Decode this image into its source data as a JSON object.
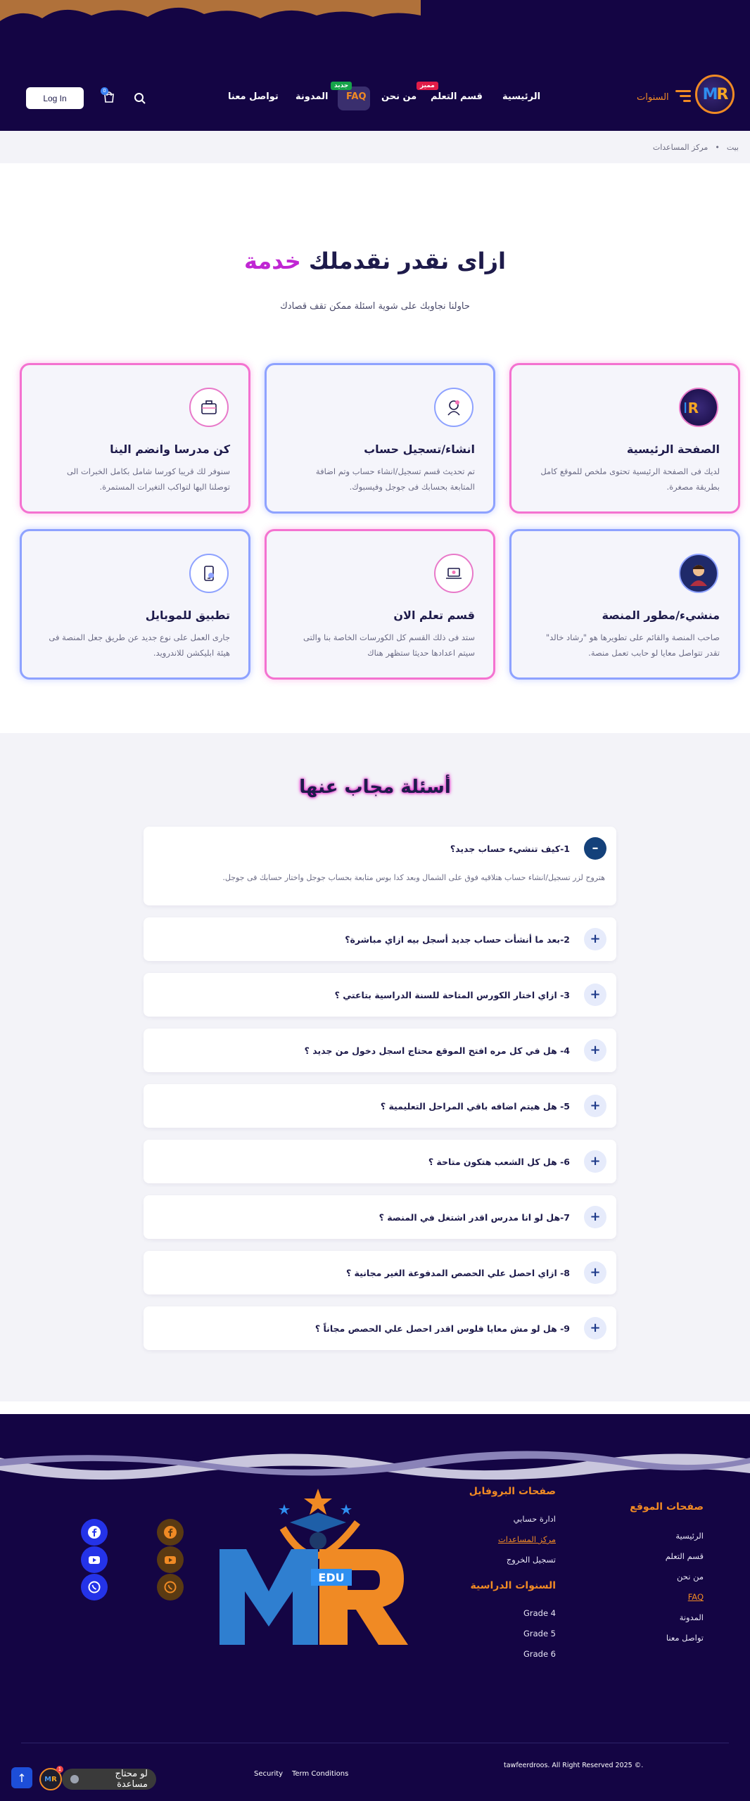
{
  "header": {
    "years_label": "السنوات",
    "logo_text": {
      "m": "M",
      "r": "R"
    },
    "nav": [
      {
        "label": "الرئيسية"
      },
      {
        "label": "قسم التعلم",
        "badge": "مميز"
      },
      {
        "label": "من نحن"
      },
      {
        "label": "FAQ",
        "badge": "جديد"
      },
      {
        "label": "المدونة"
      },
      {
        "label": "تواصل معنا"
      }
    ],
    "cart_count": "0",
    "login_label": "Log In",
    "colors": {
      "bg": "#140544",
      "accent": "#f08a24",
      "badge_red": "#e11d48",
      "badge_green": "#16a34a"
    }
  },
  "breadcrumb": {
    "home": "بيت",
    "separator": "•",
    "current": "مركز المساعدات"
  },
  "hero": {
    "title_main": "ازاى نقدر نقدملك",
    "title_highlight": "خدمة",
    "subtitle": "حاولنا نجاوبك على شوية اسئلة ممكن تقف قصادك"
  },
  "cards": [
    {
      "title": "الصفحة الرئيسية",
      "desc": "لديك فى الصفحة الرئيسية تحتوى ملخص للموقع كامل بطريقة مصغرة.",
      "icon": "logo-icon"
    },
    {
      "title": "انشاء/تسجيل حساب",
      "desc": "تم تحديث قسم تسجيل/انشاء حساب وتم اضافة المتابعة بحسابك فى جوجل وفيسبوك.",
      "icon": "user-icon"
    },
    {
      "title": "كن مدرسا وانضم الينا",
      "desc": "سنوفر لك قريبا كورسا شامل بكامل الخبرات الى توصلنا اليها لتواكب التغيرات المستمرة.",
      "icon": "briefcase-icon"
    },
    {
      "title": "منشيء/مطور المنصة",
      "desc": "صاحب المنصة والقائم على تطويرها هو \"رشاد خالد\" تقدر تتواصل معايا لو حابب تعمل منصة.",
      "icon": "avatar-icon"
    },
    {
      "title": "قسم تعلم الان",
      "desc": "ستد فى ذلك القسم كل الكورسات الخاصة بنا والتى سيتم اعدادها حديثا ستظهر هناك",
      "icon": "laptop-icon"
    },
    {
      "title": "تطبيق للموبايل",
      "desc": "جارى العمل على نوع جديد عن طريق جعل المنصة فى هيئة ابليكشن للاندرويد.",
      "icon": "mobile-icon"
    }
  ],
  "faq": {
    "title": "أسئلة مجاب عنها",
    "items": [
      {
        "q": "1-كيف تنشيء حساب جديد؟",
        "a": "هتروح لزر تسجيل/انشاء حساب هتلاقيه فوق على الشمال وبعد كدا بوس متابعة بحساب جوجل واختار حسابك فى جوجل.",
        "open": true
      },
      {
        "q": "2-بعد ما أنشأت حساب جديد أسجل بيه ازاي مباشرة؟"
      },
      {
        "q": "3- ازاي اختار الكورس المتاحة للسنة الدراسية بتاعتي ؟"
      },
      {
        "q": "4- هل في كل مره افتح الموقع محتاج اسجل دخول من جديد ؟"
      },
      {
        "q": "5- هل هيتم اضافه باقي المراحل التعليمية ؟"
      },
      {
        "q": "6- هل كل الشعب هتكون متاحة ؟"
      },
      {
        "q": "7-هل لو انا مدرس اقدر اشتغل في المنصة ؟"
      },
      {
        "q": "8- ازاي احصل علي الحصص المدفوعة الغير مجانية ؟"
      },
      {
        "q": "9- هل لو مش معايا فلوس اقدر احصل علي الحصص مجاناً ؟"
      }
    ]
  },
  "footer": {
    "site_pages_title": "صفحات الموقع",
    "site_pages": [
      "الرئيسية",
      "قسم التعلم",
      "من نحن",
      "FAQ",
      "المدونة",
      "تواصل معنا"
    ],
    "profile_title": "صفحات البروفايل",
    "profile_pages": [
      "ادارة حسابي",
      "مركز المساعدات",
      "تسجيل الخروج"
    ],
    "years_title": "السنوات الدراسية",
    "years": [
      "Grade 4",
      "Grade 5",
      "Grade 6"
    ],
    "logo_text": {
      "m": "M",
      "r": "R",
      "edu": "EDU"
    },
    "social": [
      "facebook-icon",
      "youtube-icon",
      "whatsapp-icon"
    ],
    "copyright": "tawfeerdroos. All Right Reserved 2025 ©.",
    "legal": [
      "Term Conditions",
      "Security"
    ],
    "help_label": "لو محتاج مساعدة",
    "help_count": "1"
  }
}
